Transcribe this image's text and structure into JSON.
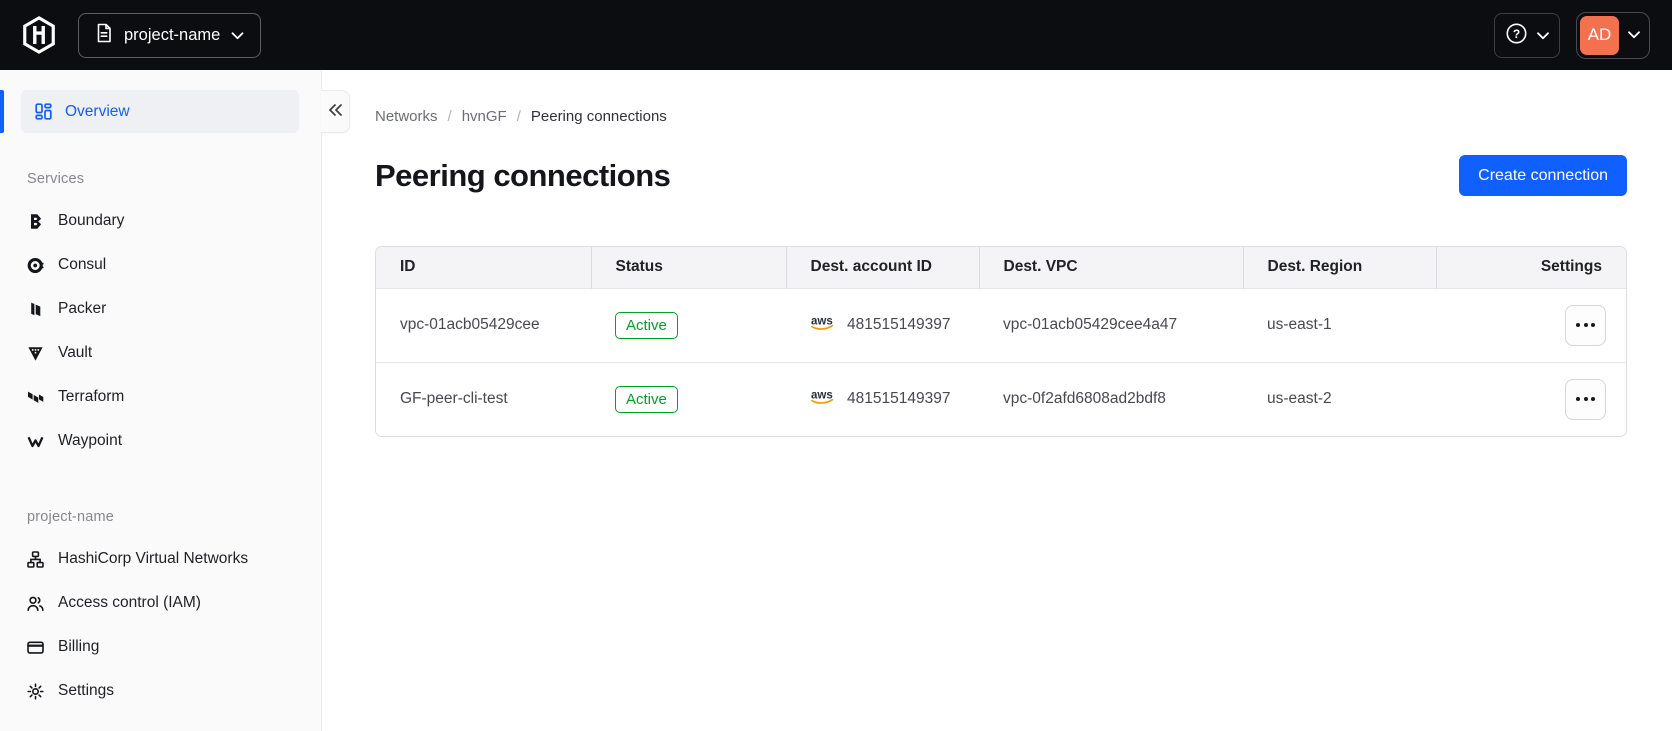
{
  "colors": {
    "accent_blue": "#1060FF",
    "success_green": "#00A324",
    "avatar_bg": "#F4714F",
    "aws_orange": "#FF9900",
    "topbar_bg": "#0C0D10"
  },
  "topbar": {
    "project_switcher_label": "project-name",
    "help_glyph": "?",
    "avatar_initials": "AD"
  },
  "sidebar": {
    "overview_label": "Overview",
    "sections": [
      {
        "heading": "Services",
        "items": [
          {
            "label": "Boundary"
          },
          {
            "label": "Consul"
          },
          {
            "label": "Packer"
          },
          {
            "label": "Vault"
          },
          {
            "label": "Terraform"
          },
          {
            "label": "Waypoint"
          }
        ]
      },
      {
        "heading": "project-name",
        "items": [
          {
            "label": "HashiCorp Virtual Networks"
          },
          {
            "label": "Access control (IAM)"
          },
          {
            "label": "Billing"
          },
          {
            "label": "Settings"
          }
        ]
      }
    ]
  },
  "breadcrumb": {
    "separator": "/",
    "items": [
      {
        "label": "Networks"
      },
      {
        "label": "hvnGF"
      },
      {
        "label": "Peering connections"
      }
    ]
  },
  "page": {
    "title": "Peering connections",
    "create_button_label": "Create connection"
  },
  "table": {
    "columns": [
      "ID",
      "Status",
      "Dest. account ID",
      "Dest. VPC",
      "Dest. Region",
      "Settings"
    ],
    "rows": [
      {
        "id": "vpc-01acb05429cee",
        "status": "Active",
        "provider": "aws",
        "dest_account_id": "481515149397",
        "dest_vpc": "vpc-01acb05429cee4a47",
        "dest_region": "us-east-1"
      },
      {
        "id": "GF-peer-cli-test",
        "status": "Active",
        "provider": "aws",
        "dest_account_id": "481515149397",
        "dest_vpc": "vpc-0f2afd6808ad2bdf8",
        "dest_region": "us-east-2"
      }
    ]
  }
}
